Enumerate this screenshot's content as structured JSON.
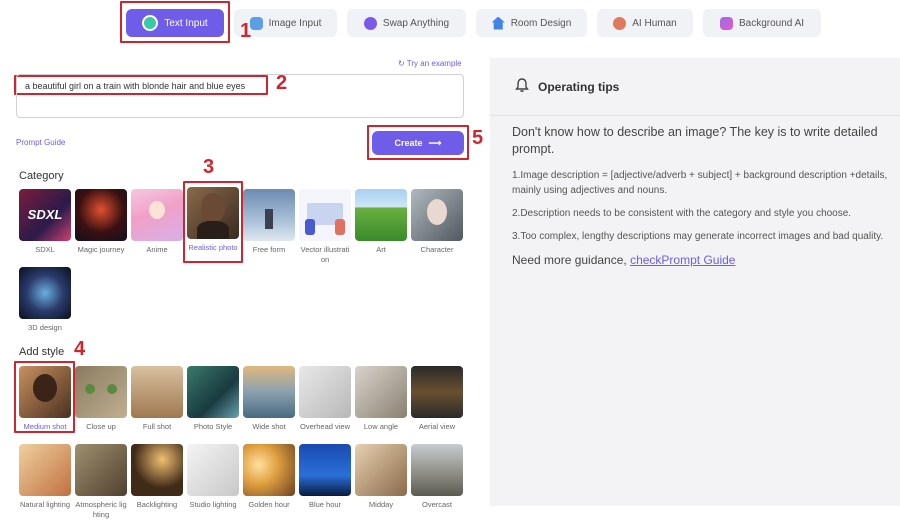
{
  "tabs": [
    {
      "label": "Text Input",
      "icon": "text-input-icon"
    },
    {
      "label": "Image Input",
      "icon": "image-input-icon"
    },
    {
      "label": "Swap Anything",
      "icon": "swap-icon"
    },
    {
      "label": "Room Design",
      "icon": "home-icon"
    },
    {
      "label": "AI Human",
      "icon": "human-icon"
    },
    {
      "label": "Background AI",
      "icon": "background-icon"
    }
  ],
  "annotations": [
    "1",
    "2",
    "3",
    "4",
    "5"
  ],
  "prompt": {
    "try_example": "Try an example",
    "value": "a beautiful girl on a train with blonde hair and blue eyes",
    "guide_link": "Prompt Guide",
    "create_label": "Create"
  },
  "category": {
    "title": "Category",
    "items": [
      "SDXL",
      "Magic journey",
      "Anime",
      "Realistic photo",
      "Free form",
      "Vector illustration",
      "Art",
      "Character",
      "3D design"
    ],
    "selected": "Realistic photo",
    "sdxl_text": "SDXL"
  },
  "style": {
    "title": "Add style",
    "items": [
      "Medium shot",
      "Close up",
      "Full shot",
      "Photo Style",
      "Wide shot",
      "Overhead view",
      "Low angle",
      "Aerial view",
      "Natural lighting",
      "Atmospheric lighting",
      "Backlighting",
      "Studio lighting",
      "Golden hour",
      "Blue hour",
      "Midday",
      "Overcast"
    ],
    "selected": "Medium shot"
  },
  "tips": {
    "title": "Operating tips",
    "lead": "Don't know how to describe an image? The key is to write detailed prompt.",
    "items": [
      "1.Image description = [adjective/adverb + subject] + background description +details, mainly using adjectives and nouns.",
      "2.Description needs to be consistent with the category and style you choose.",
      "3.Too complex, lengthy descriptions may generate incorrect images and bad quality."
    ],
    "more_text": "Need more guidance, ",
    "more_link": "checkPrompt Guide"
  },
  "colors": {
    "accent": "#6f5ce8",
    "highlight": "#d0252e",
    "panel": "#f3f3f5"
  }
}
